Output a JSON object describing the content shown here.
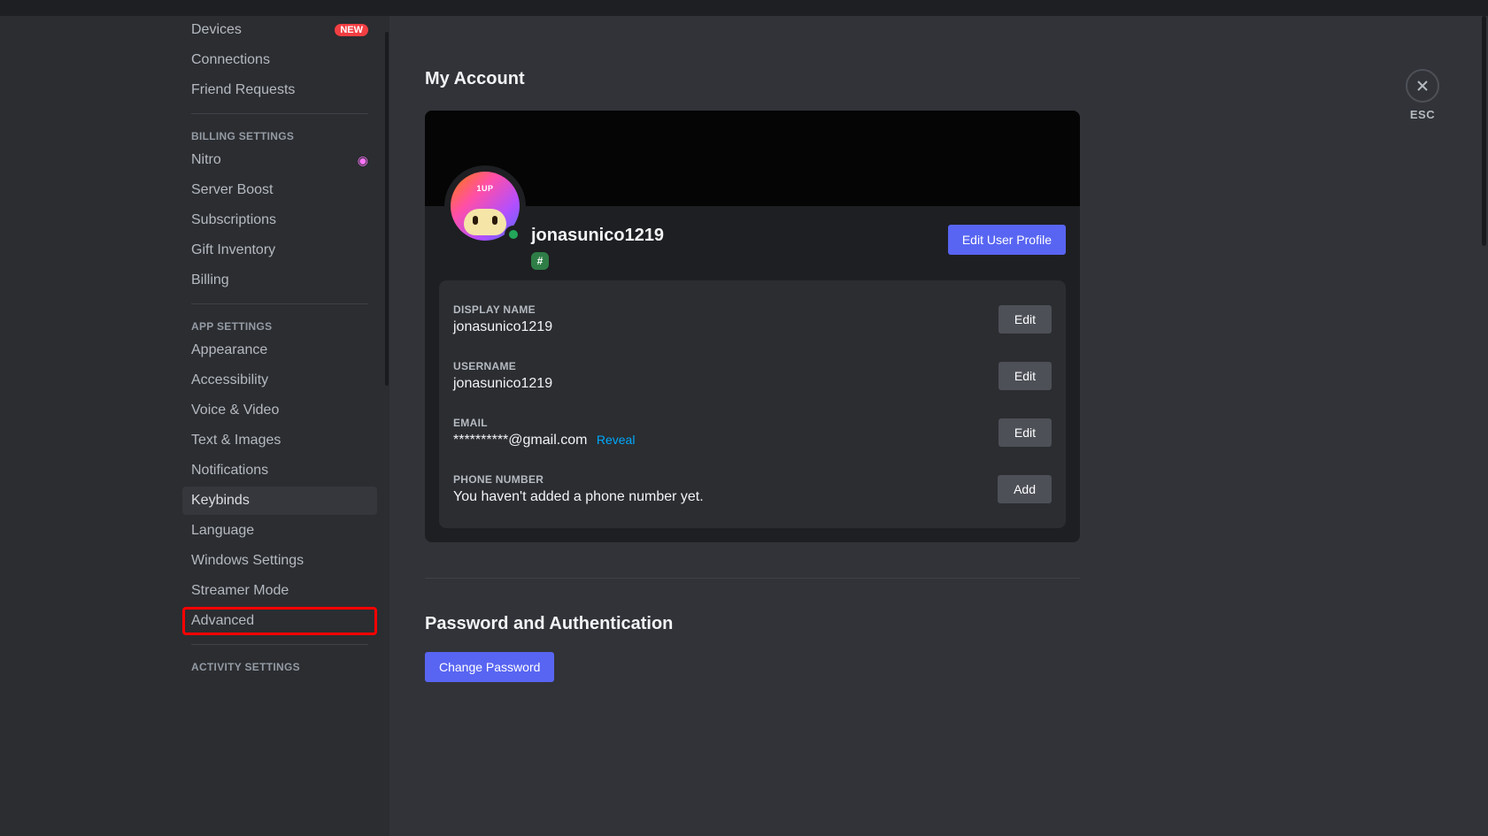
{
  "sidebar": {
    "items_top": [
      {
        "label": "Devices",
        "badge": "NEW"
      },
      {
        "label": "Connections"
      },
      {
        "label": "Friend Requests"
      }
    ],
    "billing_header": "BILLING SETTINGS",
    "billing_items": [
      {
        "label": "Nitro",
        "icon": "nitro"
      },
      {
        "label": "Server Boost"
      },
      {
        "label": "Subscriptions"
      },
      {
        "label": "Gift Inventory"
      },
      {
        "label": "Billing"
      }
    ],
    "app_header": "APP SETTINGS",
    "app_items": [
      {
        "label": "Appearance"
      },
      {
        "label": "Accessibility"
      },
      {
        "label": "Voice & Video"
      },
      {
        "label": "Text & Images"
      },
      {
        "label": "Notifications"
      },
      {
        "label": "Keybinds",
        "hovered": true
      },
      {
        "label": "Language"
      },
      {
        "label": "Windows Settings"
      },
      {
        "label": "Streamer Mode"
      },
      {
        "label": "Advanced",
        "highlighted": true
      }
    ],
    "activity_header": "ACTIVITY SETTINGS"
  },
  "main": {
    "page_title": "My Account",
    "username": "jonasunico1219",
    "avatar_text": "1UP",
    "hash_symbol": "#",
    "edit_profile_label": "Edit User Profile",
    "fields": {
      "display_name": {
        "label": "DISPLAY NAME",
        "value": "jonasunico1219",
        "button": "Edit"
      },
      "username": {
        "label": "USERNAME",
        "value": "jonasunico1219",
        "button": "Edit"
      },
      "email": {
        "label": "EMAIL",
        "value": "**********@gmail.com",
        "reveal": "Reveal",
        "button": "Edit"
      },
      "phone": {
        "label": "PHONE NUMBER",
        "value": "You haven't added a phone number yet.",
        "button": "Add"
      }
    },
    "password_section_title": "Password and Authentication",
    "change_password_label": "Change Password"
  },
  "close": {
    "label": "ESC"
  }
}
